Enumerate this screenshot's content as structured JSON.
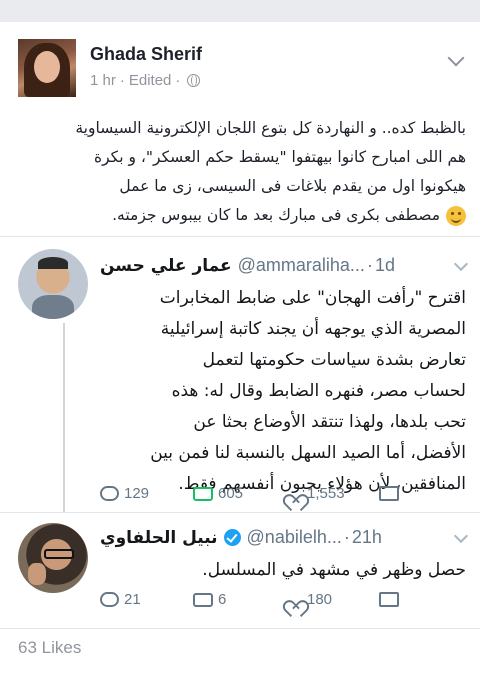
{
  "post": {
    "author": "Ghada Sherif",
    "time": "1 hr",
    "separator": "·",
    "edited": "Edited",
    "separator2": "·",
    "text_lines": [
      "بالظبط كده.. و النهاردة كل بتوع اللجان الإلكترونية السيساوية",
      "هم اللى امبارح كانوا بيهتفوا \"يسقط حكم العسكر\"، و بكرة",
      "هيكونوا اول من يقدم بلاغات فى السيسى، زى ما عمل",
      "مصطفى بكرى فى مبارك بعد ما كان بيبوس جزمته."
    ],
    "emoji": "smiling-face-emoji"
  },
  "tweets": [
    {
      "name": "عمار علي حسن",
      "handle": "@ammaraliha...",
      "sep": "·",
      "time": "1d",
      "verified": false,
      "body_lines": [
        "اقترح \"رأفت الهجان\" على ضابط المخابرات",
        "المصرية الذي يوجهه أن يجند كاتبة إسرائيلية",
        "تعارض بشدة سياسات حكومتها لتعمل",
        "لحساب مصر، فنهره الضابط وقال له: هذه",
        "تحب بلدها، ولهذا تنتقد الأوضاع بحثا عن",
        "الأفضل، أما الصيد السهل بالنسبة لنا فمن بين",
        "المنافقين، لأن هؤلاء يحبون أنفسهم فقط."
      ],
      "replies": "129",
      "retweets": "605",
      "likes": "1,553"
    },
    {
      "name": "نبيل الحلفاوي",
      "handle": "@nabilelh...",
      "sep": "·",
      "time": "21h",
      "verified": true,
      "body_lines": [
        "حصل وظهر في مشهد في المسلسل."
      ],
      "replies": "21",
      "retweets": "6",
      "likes": "180"
    }
  ],
  "footer": {
    "likes": "63 Likes"
  },
  "colors": {
    "fb_grey": "#90949c",
    "twitter_grey": "#657786",
    "retweet_green": "#17bf63",
    "verified_blue": "#1da1f2"
  }
}
